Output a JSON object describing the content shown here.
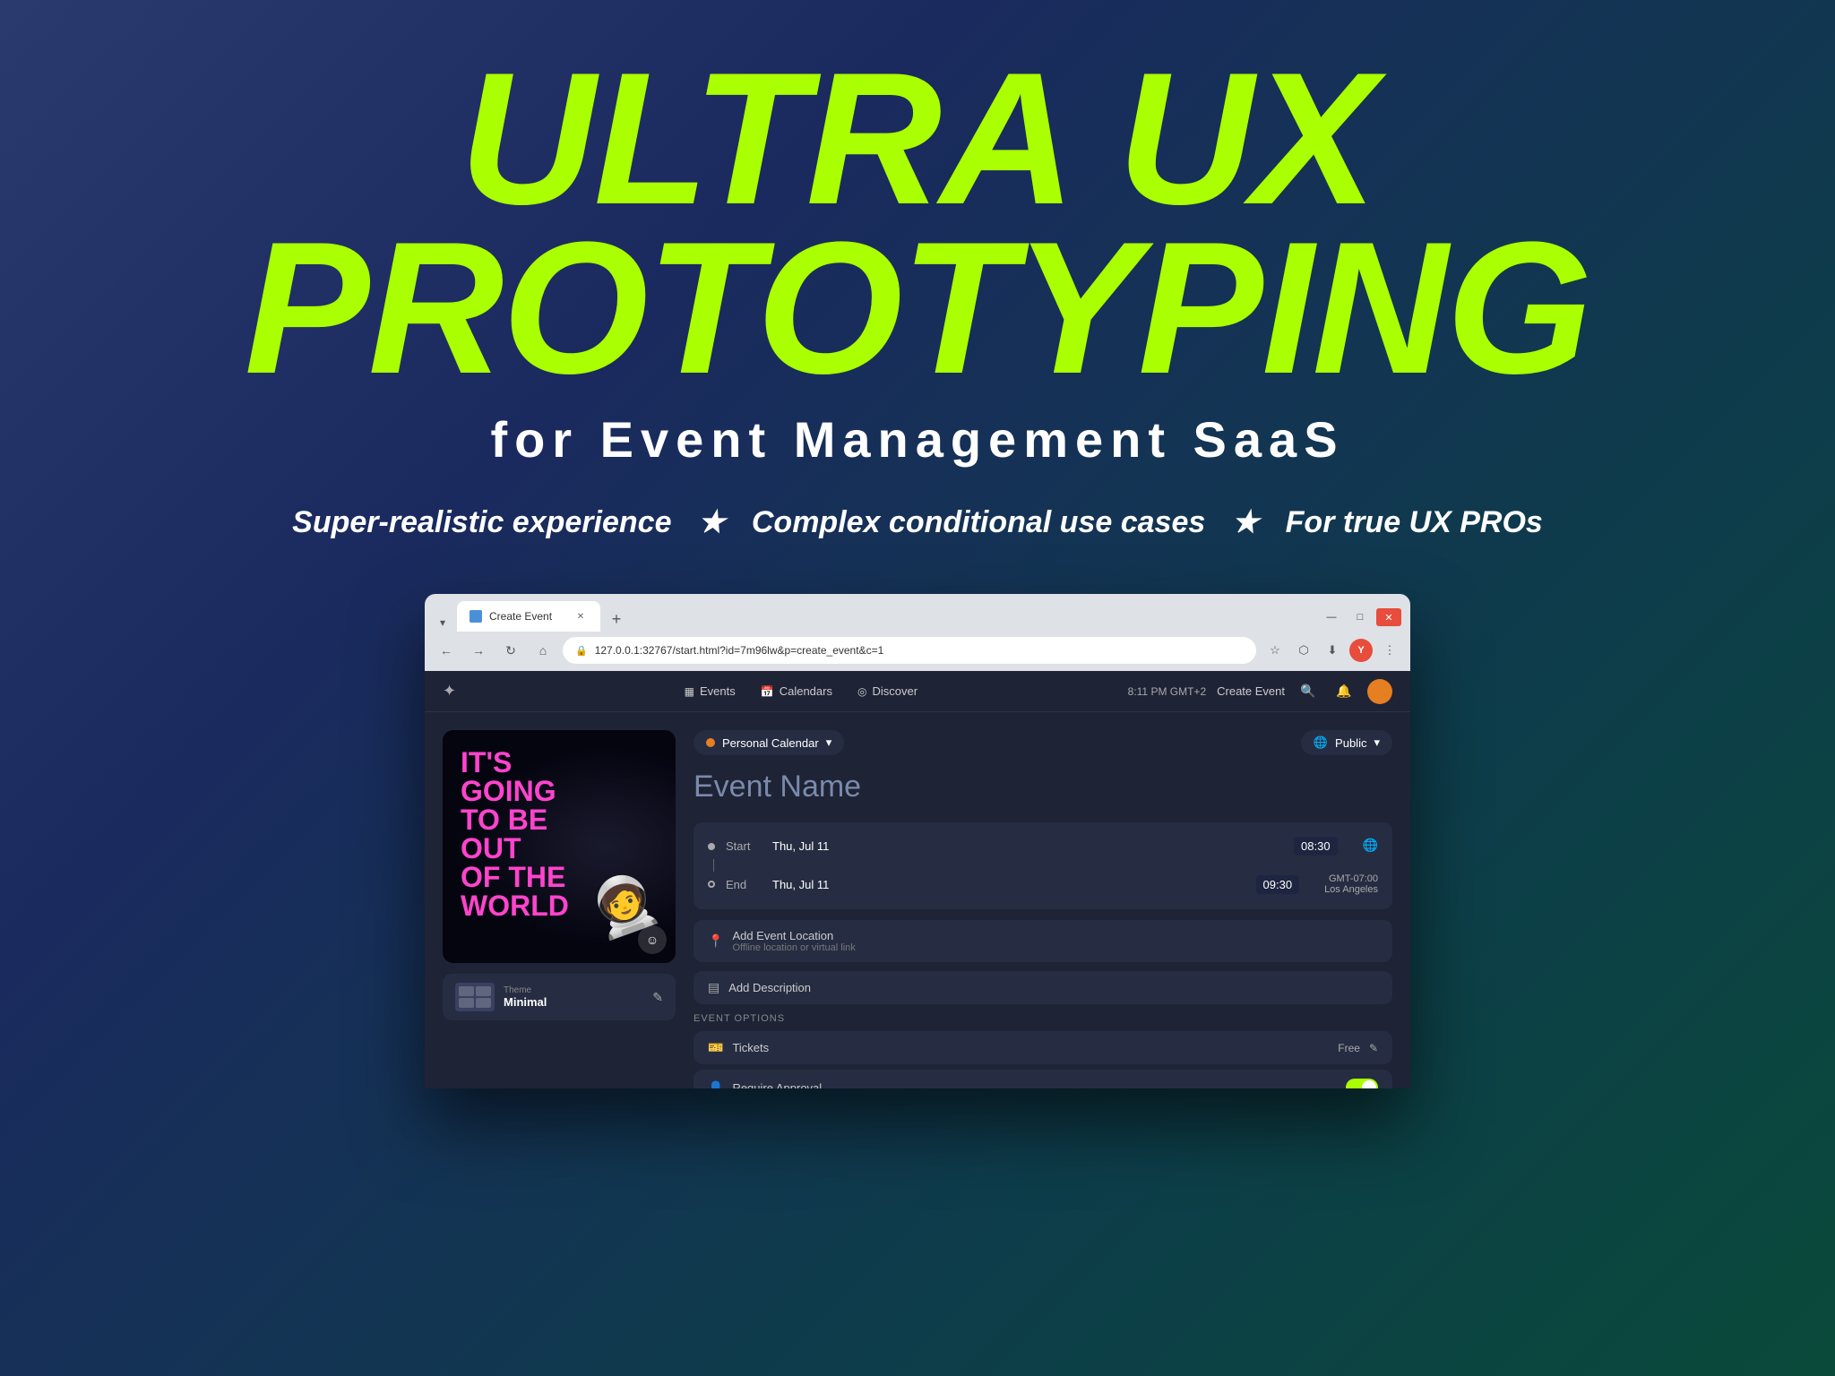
{
  "background": {
    "gradient": "linear-gradient(135deg, #2a3a6e 0%, #1a2a5e 30%, #0d3d4a 70%, #0a4a3a 100%)"
  },
  "hero": {
    "title_line1": "ULTRA UX",
    "title_line2": "PROTOTYPING",
    "subtitle": "for Event Management SaaS",
    "tagline_part1": "Super-realistic experience",
    "tagline_star": "★",
    "tagline_part2": "Complex conditional use cases",
    "tagline_part3": "For true UX PROs"
  },
  "browser": {
    "tab_label": "Create Event",
    "url": "127.0.0.1:32767/start.html?id=7m96lw&p=create_event&c=1",
    "url_prefix": "127.0.0.1:32767/start.html?id=7m96lw&p=create_event&c=1"
  },
  "nav": {
    "events_label": "Events",
    "calendars_label": "Calendars",
    "discover_label": "Discover",
    "time": "8:11 PM GMT+2",
    "create_event": "Create Event"
  },
  "event_form": {
    "calendar": "Personal Calendar",
    "visibility": "Public",
    "event_name_placeholder": "Event Name",
    "start_label": "Start",
    "end_label": "End",
    "start_date": "Thu, Jul 11",
    "end_date": "Thu, Jul 11",
    "start_time": "08:30",
    "end_time": "09:30",
    "timezone": "GMT-07:00",
    "timezone_city": "Los Angeles",
    "location_title": "Add Event Location",
    "location_subtitle": "Offline location or virtual link",
    "description_title": "Add Description",
    "event_options_label": "Event Options",
    "tickets_label": "Tickets",
    "tickets_value": "Free",
    "require_approval_label": "Require Approval"
  },
  "theme": {
    "label": "Theme",
    "name": "Minimal"
  },
  "event_image": {
    "text_line1": "IT'S",
    "text_line2": "GOING",
    "text_line3": "TO BE",
    "text_line4": "OUT",
    "text_line5": "OF THE",
    "text_line6": "WORLD"
  }
}
